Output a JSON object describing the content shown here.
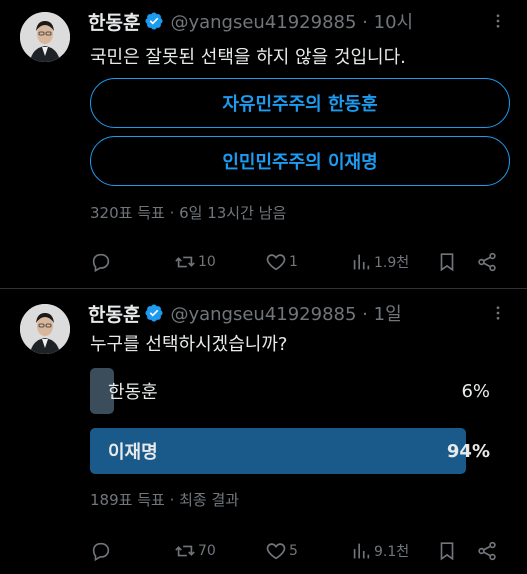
{
  "tweets": [
    {
      "name": "한동훈",
      "handle": "@yangseu41929885 · 10시",
      "text": "국민은 잘못된 선택을 하지 않을 것입니다.",
      "poll_options": [
        "자유민주주의 한동훈",
        "인민민주주의 이재명"
      ],
      "poll_meta": "320표 득표 · 6일 13시간 남음",
      "actions": {
        "replies": "",
        "retweets": "10",
        "likes": "1",
        "views": "1.9천"
      }
    },
    {
      "name": "한동훈",
      "handle": "@yangseu41929885 · 1일",
      "text": "누구를 선택하시겠습니까?",
      "poll_results": [
        {
          "label": "한동훈",
          "percent_text": "6%",
          "fraction": 0.06
        },
        {
          "label": "이재명",
          "percent_text": "94%",
          "fraction": 0.94
        }
      ],
      "poll_meta": "189표 득표 · 최종 결과",
      "actions": {
        "replies": "",
        "retweets": "70",
        "likes": "5",
        "views": "9.1천"
      }
    }
  ],
  "colors": {
    "accent": "#1d9bf0",
    "muted": "#71767b",
    "text": "#e7e9ea",
    "background": "#000000",
    "winner_bar": "#1a5a8a",
    "loser_bar": "#3b4c5a"
  },
  "icons": [
    "verified-badge-icon",
    "more-icon",
    "reply-icon",
    "retweet-icon",
    "like-icon",
    "views-icon",
    "bookmark-icon",
    "share-icon"
  ]
}
